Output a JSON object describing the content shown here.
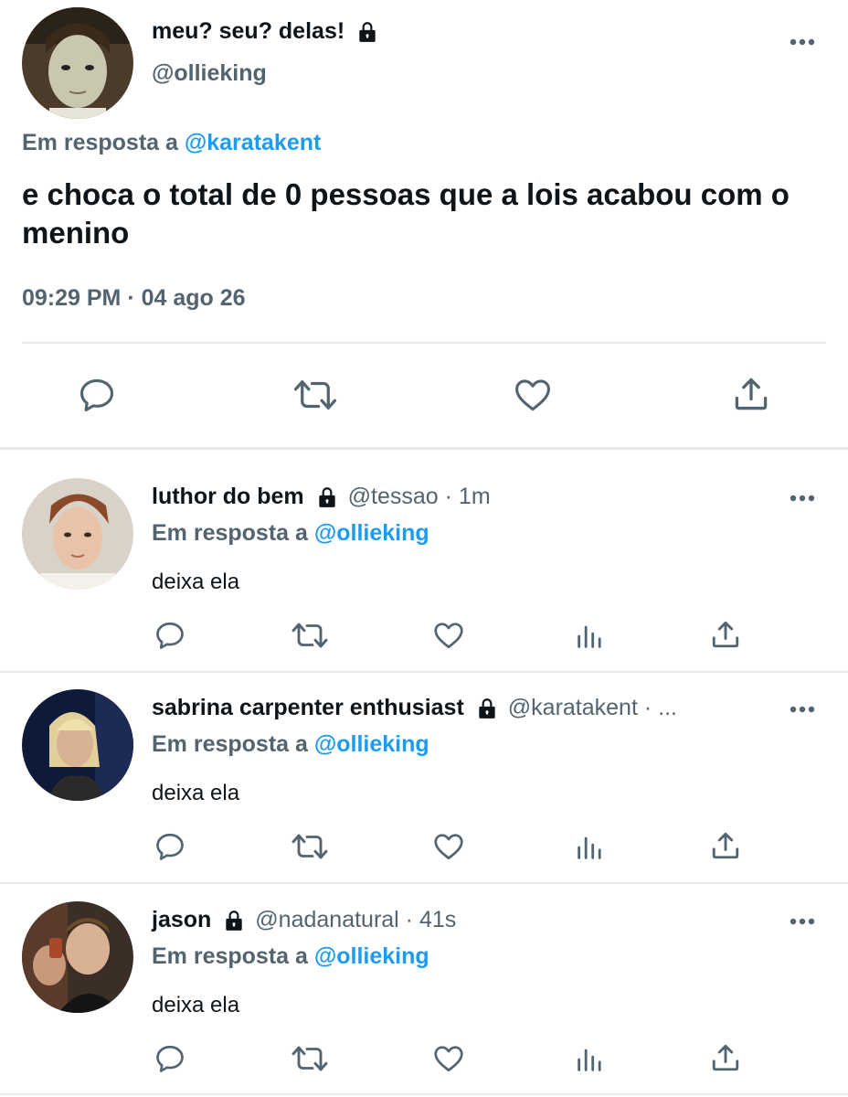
{
  "main_tweet": {
    "display_name": "meu? seu? delas!",
    "handle": "@ollieking",
    "reply_prefix": "Em resposta a",
    "reply_mention": "@karatakent",
    "text": "e choca o total de 0 pessoas que a lois acabou com o menino",
    "timestamp": "09:29 PM · 04 ago 26",
    "actions": [
      "reply-icon",
      "retweet-icon",
      "like-icon",
      "share-icon"
    ]
  },
  "replies": [
    {
      "display_name": "luthor do bem",
      "meta": "@tessao · 1m",
      "reply_prefix": "Em resposta a",
      "reply_mention": "@ollieking",
      "text": "deixa ela"
    },
    {
      "display_name": "sabrina carpenter enthusiast",
      "meta": "@karatakent · ...",
      "reply_prefix": "Em resposta a",
      "reply_mention": "@ollieking",
      "text": "deixa ela"
    },
    {
      "display_name": "jason",
      "meta": "@nadanatural · 41s",
      "reply_prefix": "Em resposta a",
      "reply_mention": "@ollieking",
      "text": "deixa ela"
    }
  ],
  "reply_actions": [
    "reply-icon",
    "retweet-icon",
    "like-icon",
    "views-icon",
    "share-icon"
  ],
  "colors": {
    "text_primary": "#0f1419",
    "text_secondary": "#536471",
    "link": "#1d9bf0",
    "divider": "#e7e9ea"
  }
}
